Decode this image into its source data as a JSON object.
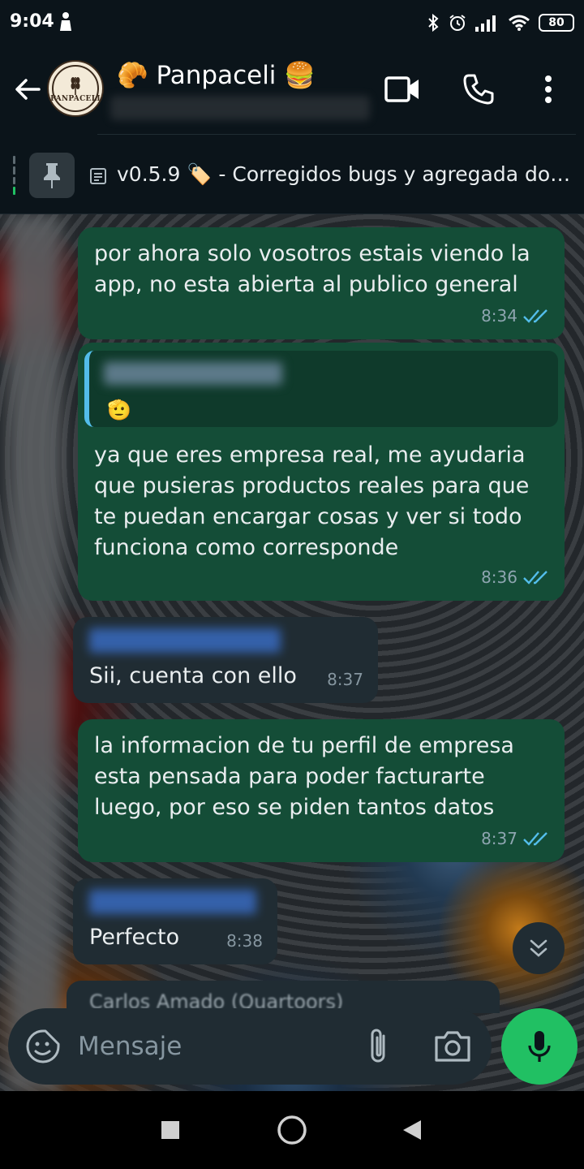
{
  "status_bar": {
    "time": "9:04",
    "battery": "80"
  },
  "header": {
    "title": "🥐 Panpaceli 🍔",
    "avatar_brand": "PANPACELI",
    "subtitle_blurred": ""
  },
  "pinned": {
    "text": "v0.5.9 🏷️ - Corregidos bugs y agregada doc…"
  },
  "messages": [
    {
      "dir": "out",
      "text": "por ahora solo vosotros estais viendo la app, no esta abierta al publico general",
      "time": "8:34"
    },
    {
      "dir": "out",
      "quote_emoji": "🫡",
      "text": "ya que eres empresa real, me ayudaria que pusieras productos reales para que te puedan encargar cosas y ver si todo funciona como corresponde",
      "time": "8:36"
    },
    {
      "dir": "in",
      "text": "Sii, cuenta con ello",
      "time": "8:37"
    },
    {
      "dir": "out",
      "text": "la informacion de tu perfil de empresa esta pensada para poder facturarte luego, por eso se piden tantos datos",
      "time": "8:37"
    },
    {
      "dir": "in",
      "text": "Perfecto",
      "time": "8:38"
    }
  ],
  "partial_next": "Carlos Amado (Quartoors)",
  "composer": {
    "placeholder": "Mensaje"
  },
  "colors": {
    "outgoing": "#144d37",
    "incoming": "#202c33",
    "accent": "#21c063",
    "read_ticks": "#53bdeb"
  }
}
